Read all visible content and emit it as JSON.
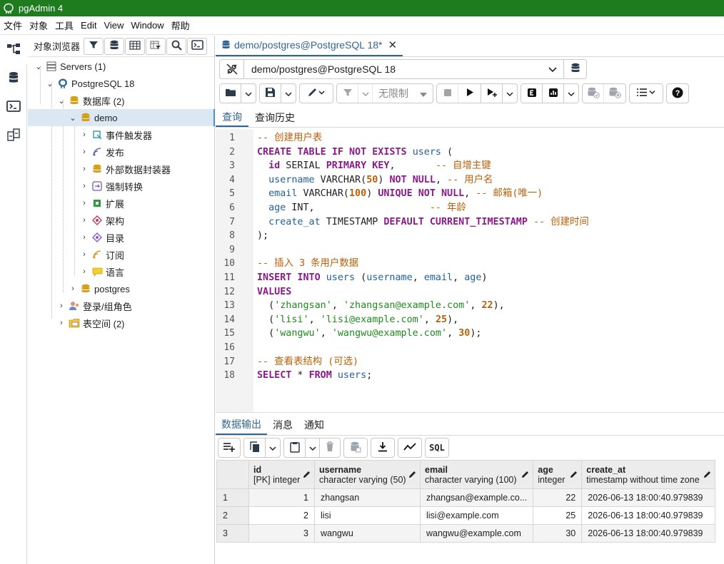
{
  "app": {
    "title": "pgAdmin 4"
  },
  "menu": [
    "文件",
    "对象",
    "工具",
    "Edit",
    "View",
    "Window",
    "帮助"
  ],
  "browser": {
    "title": "对象浏览器",
    "tree": {
      "servers": "Servers (1)",
      "pg": "PostgreSQL 18",
      "databases": "数据库 (2)",
      "demo": "demo",
      "event_triggers": "事件触发器",
      "publications": "发布",
      "fdw": "外部数据封装器",
      "casts": "强制转换",
      "extensions": "扩展",
      "schemas": "架构",
      "catalogs": "目录",
      "subscriptions": "订阅",
      "languages": "语言",
      "postgres": "postgres",
      "roles": "登录/组角色",
      "tablespaces": "表空间 (2)"
    }
  },
  "query": {
    "tab_label": "demo/postgres@PostgreSQL 18*",
    "connection": "demo/postgres@PostgreSQL 18",
    "limit_label": "无限制",
    "sql_button": "SQL",
    "subtabs": [
      "查询",
      "查询历史"
    ],
    "line_numbers": [
      "1",
      "2",
      "3",
      "4",
      "5",
      "6",
      "7",
      "8",
      "9",
      "10",
      "11",
      "12",
      "13",
      "14",
      "15",
      "16",
      "17",
      "18"
    ],
    "code": {
      "c1": "-- 创建用户表",
      "c3": "-- 自增主键",
      "c4": "-- 用户名",
      "c5": "-- 邮箱(唯一)",
      "c6": "-- 年龄",
      "c7": "-- 创建时间",
      "c10": "-- 插入 3 条用户数据",
      "c17": "-- 查看表结构 (可选)"
    }
  },
  "output": {
    "tabs": [
      "数据输出",
      "消息",
      "通知"
    ],
    "columns": [
      {
        "name": "id",
        "type": "[PK] integer"
      },
      {
        "name": "username",
        "type": "character varying (50)"
      },
      {
        "name": "email",
        "type": "character varying (100)"
      },
      {
        "name": "age",
        "type": "integer"
      },
      {
        "name": "create_at",
        "type": "timestamp without time zone"
      }
    ],
    "rows": [
      {
        "n": "1",
        "id": "1",
        "username": "zhangsan",
        "email": "zhangsan@example.co...",
        "age": "22",
        "create_at": "2026-06-13 18:00:40.979839"
      },
      {
        "n": "2",
        "id": "2",
        "username": "lisi",
        "email": "lisi@example.com",
        "age": "25",
        "create_at": "2026-06-13 18:00:40.979839"
      },
      {
        "n": "3",
        "id": "3",
        "username": "wangwu",
        "email": "wangwu@example.com",
        "age": "30",
        "create_at": "2026-06-13 18:00:40.979839"
      }
    ]
  }
}
